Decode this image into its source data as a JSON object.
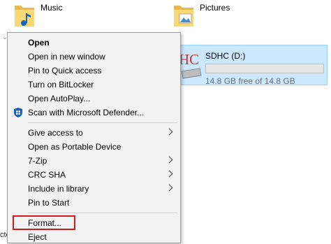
{
  "folders": [
    {
      "name": "Music",
      "icon": "music-folder-icon"
    },
    {
      "name": "Pictures",
      "icon": "pictures-folder-icon"
    }
  ],
  "drive": {
    "name": "SDHC (D:)",
    "free_text": "14.8 GB free of 14.8 GB",
    "used_fraction": 0.0,
    "icon_text": "HC",
    "selected_color": "#cce8ff"
  },
  "left_cut_text": "cte",
  "menu": {
    "group1": [
      {
        "label": "Open",
        "bold": true
      },
      {
        "label": "Open in new window"
      },
      {
        "label": "Pin to Quick access"
      },
      {
        "label": "Turn on BitLocker"
      },
      {
        "label": "Open AutoPlay..."
      },
      {
        "label": "Scan with Microsoft Defender...",
        "icon": "defender-shield-icon"
      }
    ],
    "group2": [
      {
        "label": "Give access to",
        "submenu": true
      },
      {
        "label": "Open as Portable Device"
      },
      {
        "label": "7-Zip",
        "submenu": true
      },
      {
        "label": "CRC SHA",
        "submenu": true
      },
      {
        "label": "Include in library",
        "submenu": true
      },
      {
        "label": "Pin to Start"
      }
    ],
    "group3": [
      {
        "label": "Format...",
        "highlighted": true
      },
      {
        "label": "Eject"
      }
    ],
    "highlight_color": "#d11a1a"
  }
}
